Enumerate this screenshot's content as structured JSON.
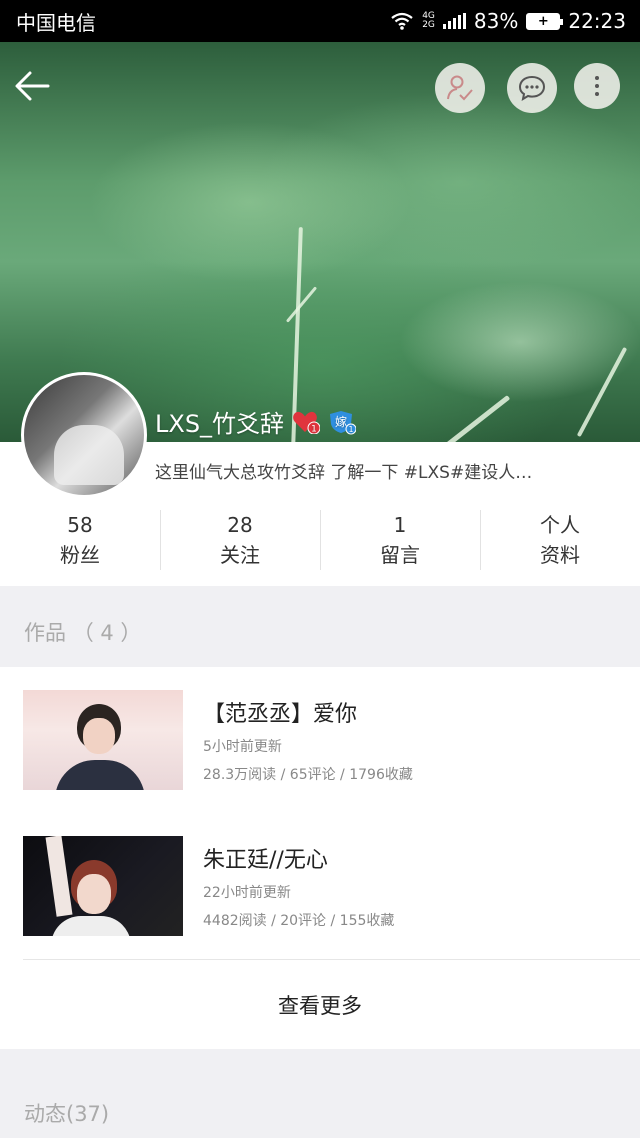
{
  "status_bar": {
    "carrier": "中国电信",
    "network": "4G",
    "network2": "2G",
    "battery": "83%",
    "time": "22:23"
  },
  "header": {
    "back_icon": "arrow-left-icon",
    "follow_icon": "user-check-icon",
    "message_icon": "chat-bubble-icon",
    "more_icon": "more-vertical-icon"
  },
  "profile": {
    "name": "LXS_竹爻辞",
    "heart_badge_count": "1",
    "shield_badge_text": "嫁",
    "shield_badge_count": "1",
    "bio": "这里仙气大总攻竹爻辞 了解一下 #LXS#建设人…"
  },
  "stats": [
    {
      "value": "58",
      "label": "粉丝"
    },
    {
      "value": "28",
      "label": "关注"
    },
    {
      "value": "1",
      "label": "留言"
    },
    {
      "value": "个人",
      "label": "资料"
    }
  ],
  "works": {
    "title": "作品",
    "count": "（ 4 ）",
    "items": [
      {
        "title": "【范丞丞】爱你",
        "time": "5小时前更新",
        "meta": "28.3万阅读 / 65评论 / 1796收藏"
      },
      {
        "title": "朱正廷//无心",
        "time": "22小时前更新",
        "meta": "4482阅读 / 20评论 / 155收藏"
      }
    ],
    "more_label": "查看更多"
  },
  "activity": {
    "title": "动态(37)"
  },
  "colors": {
    "heart": "#e0343d",
    "shield": "#2f8fe0",
    "accent_icon": "#c98a8a"
  }
}
